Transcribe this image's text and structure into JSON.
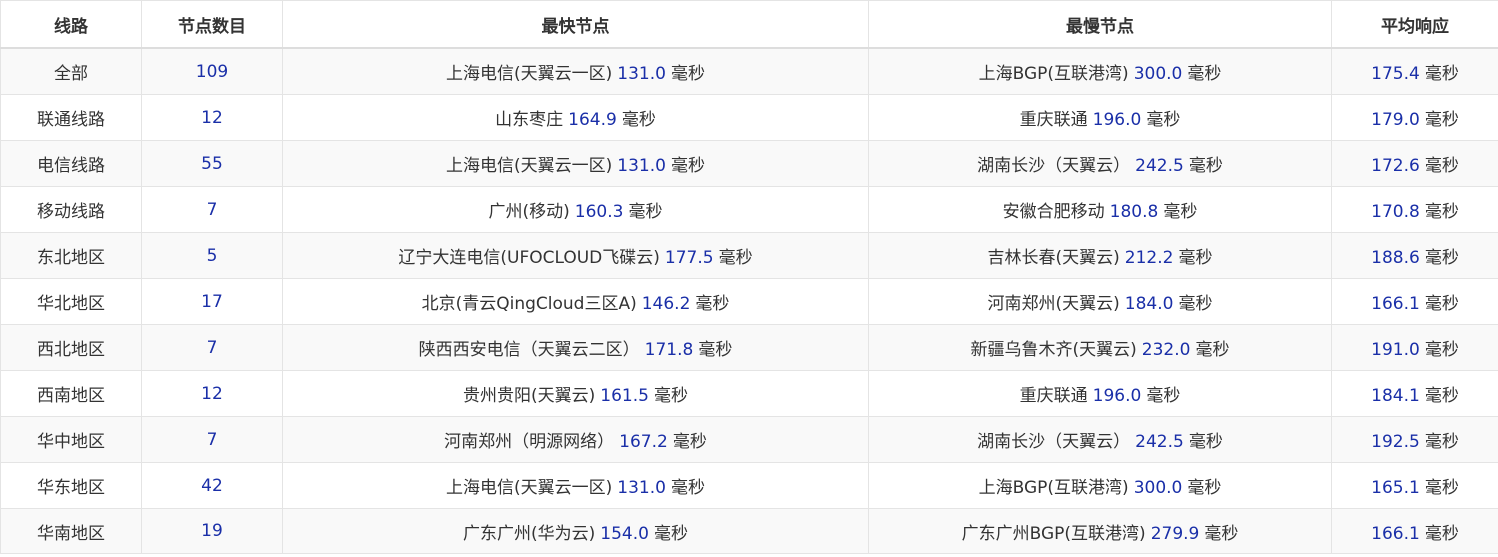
{
  "table": {
    "headers": [
      "线路",
      "节点数目",
      "最快节点",
      "最慢节点",
      "平均响应"
    ],
    "unit": "毫秒",
    "rows": [
      {
        "line": "全部",
        "count": "109",
        "fast_name": "上海电信(天翼云一区)",
        "fast_val": "131.0",
        "slow_name": "上海BGP(互联港湾)",
        "slow_val": "300.0",
        "avg_val": "175.4"
      },
      {
        "line": "联通线路",
        "count": "12",
        "fast_name": "山东枣庄",
        "fast_val": "164.9",
        "slow_name": "重庆联通",
        "slow_val": "196.0",
        "avg_val": "179.0"
      },
      {
        "line": "电信线路",
        "count": "55",
        "fast_name": "上海电信(天翼云一区)",
        "fast_val": "131.0",
        "slow_name": "湖南长沙（天翼云）",
        "slow_val": "242.5",
        "avg_val": "172.6"
      },
      {
        "line": "移动线路",
        "count": "7",
        "fast_name": "广州(移动)",
        "fast_val": "160.3",
        "slow_name": "安徽合肥移动",
        "slow_val": "180.8",
        "avg_val": "170.8"
      },
      {
        "line": "东北地区",
        "count": "5",
        "fast_name": "辽宁大连电信(UFOCLOUD飞碟云)",
        "fast_val": "177.5",
        "slow_name": "吉林长春(天翼云)",
        "slow_val": "212.2",
        "avg_val": "188.6"
      },
      {
        "line": "华北地区",
        "count": "17",
        "fast_name": "北京(青云QingCloud三区A)",
        "fast_val": "146.2",
        "slow_name": "河南郑州(天翼云)",
        "slow_val": "184.0",
        "avg_val": "166.1"
      },
      {
        "line": "西北地区",
        "count": "7",
        "fast_name": "陕西西安电信（天翼云二区）",
        "fast_val": "171.8",
        "slow_name": "新疆乌鲁木齐(天翼云)",
        "slow_val": "232.0",
        "avg_val": "191.0"
      },
      {
        "line": "西南地区",
        "count": "12",
        "fast_name": "贵州贵阳(天翼云)",
        "fast_val": "161.5",
        "slow_name": "重庆联通",
        "slow_val": "196.0",
        "avg_val": "184.1"
      },
      {
        "line": "华中地区",
        "count": "7",
        "fast_name": "河南郑州（明源网络）",
        "fast_val": "167.2",
        "slow_name": "湖南长沙（天翼云）",
        "slow_val": "242.5",
        "avg_val": "192.5"
      },
      {
        "line": "华东地区",
        "count": "42",
        "fast_name": "上海电信(天翼云一区)",
        "fast_val": "131.0",
        "slow_name": "上海BGP(互联港湾)",
        "slow_val": "300.0",
        "avg_val": "165.1"
      },
      {
        "line": "华南地区",
        "count": "19",
        "fast_name": "广东广州(华为云)",
        "fast_val": "154.0",
        "slow_name": "广东广州BGP(互联港湾)",
        "slow_val": "279.9",
        "avg_val": "166.1"
      }
    ]
  },
  "colors": {
    "value_blue": "#1a2fa8",
    "text": "#333333",
    "stripe": "#f9f9f9",
    "border": "#e4e4e4"
  }
}
